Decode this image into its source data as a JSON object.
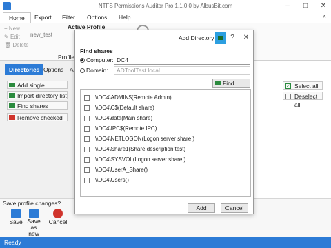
{
  "window": {
    "title": "NTFS Permissions Auditor Pro 1.1.0.0 by AlbusBit.com",
    "controls": [
      "minimize",
      "maximize",
      "close"
    ]
  },
  "menu": {
    "items": [
      "Home",
      "Export",
      "Filter",
      "Options",
      "Help"
    ],
    "active": "Home"
  },
  "ribbon": {
    "new_label": "New",
    "edit_label": "Edit",
    "delete_label": "Delete",
    "active_profile_label": "Active Profile",
    "profile_name": "new_test",
    "profile_group_label": "Profile"
  },
  "tabs": [
    "Directories",
    "Options",
    "Au"
  ],
  "sidebar_buttons": {
    "add_single": "Add single directory",
    "import_list": "Import directory list",
    "find_shares": "Find shares",
    "remove_checked": "Remove checked"
  },
  "right_buttons": {
    "select_all": "Select all",
    "deselect_all": "Deselect all"
  },
  "save_area": {
    "question": "Save profile changes?",
    "save": "Save",
    "save_as_new": "Save as new",
    "cancel": "Cancel"
  },
  "statusbar": {
    "text": "Ready"
  },
  "dialog": {
    "title": "Add Directory",
    "section_label": "Find shares",
    "computer_label": "Computer:",
    "computer_value": "DC4",
    "domain_label": "Domain:",
    "domain_value": "ADToolTest.local",
    "find_button": "Find shares",
    "shares": [
      "\\\\DC4\\ADMIN$(Remote Admin)",
      "\\\\DC4\\C$(Default share)",
      "\\\\DC4\\data(Main share)",
      "\\\\DC4\\IPC$(Remote IPC)",
      "\\\\DC4\\NETLOGON(Logon server share )",
      "\\\\DC4\\Share1(Share description test)",
      "\\\\DC4\\SYSVOL(Logon server share )",
      "\\\\DC4\\UserA_Share()",
      "\\\\DC4\\Users()"
    ],
    "add_button": "Add",
    "cancel_button": "Cancel"
  },
  "colors": {
    "accent": "#2c7bd6",
    "green_icon": "#2b8a3e",
    "red_icon": "#d0342c",
    "title_icon": "#2c9fe0"
  }
}
